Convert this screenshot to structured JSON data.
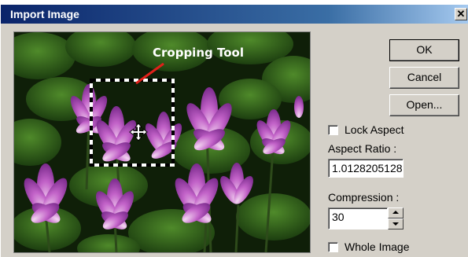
{
  "window": {
    "title": "Import Image",
    "close_label": "✕"
  },
  "preview": {
    "annotation": "Cropping Tool",
    "image_subject": "lotus-flowers-photo"
  },
  "buttons": {
    "ok": "OK",
    "cancel": "Cancel",
    "open": "Open..."
  },
  "lock_aspect": {
    "label": "Lock Aspect",
    "checked": false
  },
  "aspect_ratio": {
    "label": "Aspect Ratio :",
    "value": "1.0128205128"
  },
  "compression": {
    "label": "Compression :",
    "value": "30"
  },
  "whole_image": {
    "label": "Whole Image",
    "checked": false
  },
  "colors": {
    "titlebar": "#0a246a",
    "annotation_arrow": "#e0201a",
    "dialog_bg": "#d4d0c8"
  }
}
